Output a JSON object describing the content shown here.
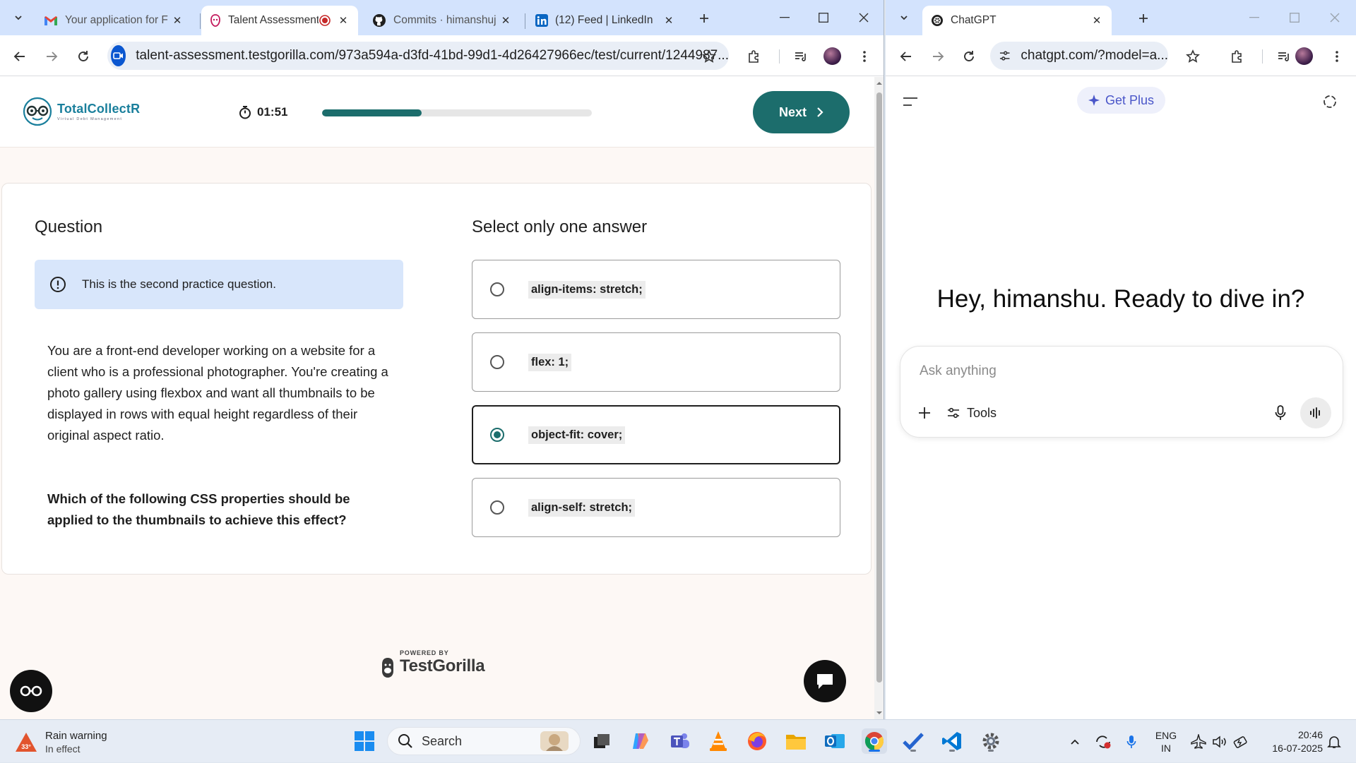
{
  "left_window": {
    "tabs": [
      {
        "title": "Your application for F",
        "icon": "gmail-icon"
      },
      {
        "title": "Talent Assessment",
        "icon": "testgorilla-icon",
        "active": true
      },
      {
        "title": "Commits · himanshuj",
        "icon": "github-icon"
      },
      {
        "title": "(12) Feed | LinkedIn",
        "icon": "linkedin-icon"
      }
    ],
    "url": "talent-assessment.testgorilla.com/973a594a-d3fd-41bd-99d1-4d26427966ec/test/current/1244987..."
  },
  "assessment": {
    "logo_name": "TotalCollectR",
    "logo_tagline": "Virtual Debt Management",
    "timer": "01:51",
    "progress": 0.37,
    "next_label": "Next",
    "question_heading": "Question",
    "notice": "This is the second practice question.",
    "question_text": "You are a front-end developer working on a website for a client who is a professional photographer. You're creating a photo gallery using flexbox and want all thumbnails to be displayed in rows with equal height regardless of their original aspect ratio.",
    "question_ask": "Which of the following CSS properties should be applied to the thumbnails to achieve this effect?",
    "answer_heading": "Select only one answer",
    "options": [
      {
        "label": "align-items: stretch;",
        "selected": false
      },
      {
        "label": "flex: 1;",
        "selected": false
      },
      {
        "label": "object-fit: cover;",
        "selected": true
      },
      {
        "label": "align-self: stretch;",
        "selected": false
      }
    ],
    "powered_by": "POWERED BY",
    "brand": "TestGorilla",
    "accent_color": "#1c6d6c"
  },
  "right_window": {
    "tab_title": "ChatGPT",
    "url": "chatgpt.com/?model=a...",
    "get_plus": "Get Plus",
    "greeting": "Hey, himanshu. Ready to dive in?",
    "placeholder": "Ask anything",
    "tools_label": "Tools"
  },
  "taskbar": {
    "weather_title": "Rain warning",
    "weather_sub": "In effect",
    "search_label": "Search",
    "lang": "ENG",
    "region": "IN",
    "time": "20:46",
    "date": "16-07-2025"
  }
}
